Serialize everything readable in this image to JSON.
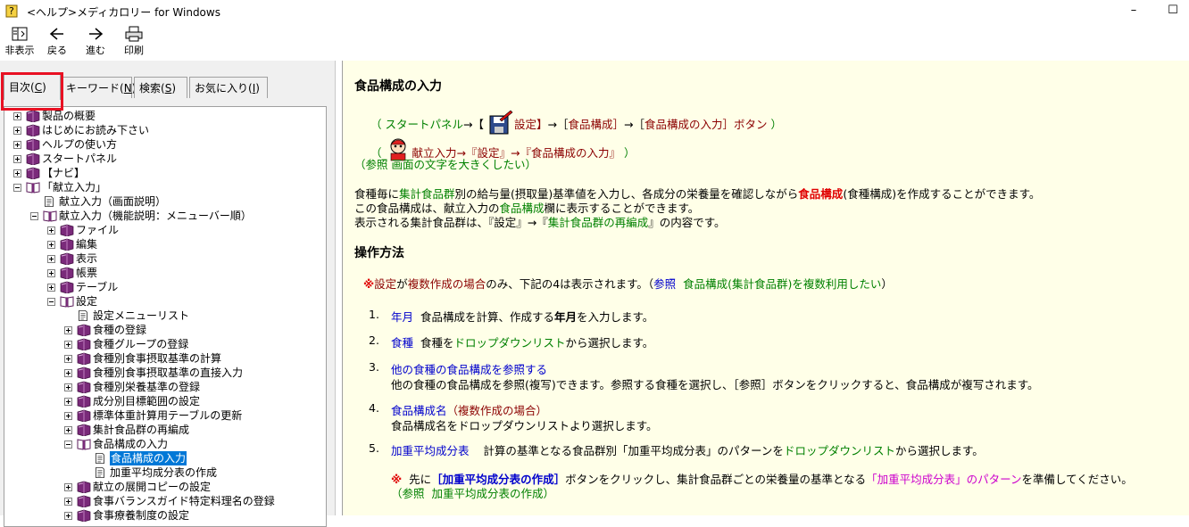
{
  "window": {
    "title": "<ヘルプ>メディカロリー for Windows",
    "minimize_glyph": "–",
    "maximize_glyph": "☐"
  },
  "toolbar": {
    "hide": "非表示",
    "back": "戻る",
    "forward": "進む",
    "print": "印刷"
  },
  "tabs": {
    "contents": "目次(C)",
    "contents_pre": "目次(",
    "contents_key": "C",
    "keyword_pre": "キーワード(",
    "keyword_key": "N",
    "search_pre": "検索(",
    "search_key": "S",
    "fav_pre": "お気に入り(",
    "fav_key": "I",
    "close": ")"
  },
  "tree": [
    {
      "label": "製品の概要",
      "level": 0,
      "type": "book",
      "exp": "plus"
    },
    {
      "label": "はじめにお読み下さい",
      "level": 0,
      "type": "book",
      "exp": "plus"
    },
    {
      "label": "ヘルプの使い方",
      "level": 0,
      "type": "book",
      "exp": "plus"
    },
    {
      "label": "スタートパネル",
      "level": 0,
      "type": "book",
      "exp": "plus"
    },
    {
      "label": "【ナビ】",
      "level": 0,
      "type": "book",
      "exp": "plus"
    },
    {
      "label": "「献立入力」",
      "level": 0,
      "type": "open",
      "exp": "minus"
    },
    {
      "label": "献立入力（画面説明）",
      "level": 1,
      "type": "page",
      "exp": ""
    },
    {
      "label": "献立入力（機能説明：メニューバー順）",
      "level": 1,
      "type": "open",
      "exp": "minus"
    },
    {
      "label": "ファイル",
      "level": 2,
      "type": "book",
      "exp": "plus"
    },
    {
      "label": "編集",
      "level": 2,
      "type": "book",
      "exp": "plus"
    },
    {
      "label": "表示",
      "level": 2,
      "type": "book",
      "exp": "plus"
    },
    {
      "label": "帳票",
      "level": 2,
      "type": "book",
      "exp": "plus"
    },
    {
      "label": "テーブル",
      "level": 2,
      "type": "book",
      "exp": "plus"
    },
    {
      "label": "設定",
      "level": 2,
      "type": "open",
      "exp": "minus"
    },
    {
      "label": "設定メニューリスト",
      "level": 3,
      "type": "page",
      "exp": ""
    },
    {
      "label": "食種の登録",
      "level": 3,
      "type": "book",
      "exp": "plus"
    },
    {
      "label": "食種グループの登録",
      "level": 3,
      "type": "book",
      "exp": "plus"
    },
    {
      "label": "食種別食事摂取基準の計算",
      "level": 3,
      "type": "book",
      "exp": "plus"
    },
    {
      "label": "食種別食事摂取基準の直接入力",
      "level": 3,
      "type": "book",
      "exp": "plus"
    },
    {
      "label": "食種別栄養基準の登録",
      "level": 3,
      "type": "book",
      "exp": "plus"
    },
    {
      "label": "成分別目標範囲の設定",
      "level": 3,
      "type": "book",
      "exp": "plus"
    },
    {
      "label": "標準体重計算用テーブルの更新",
      "level": 3,
      "type": "book",
      "exp": "plus"
    },
    {
      "label": "集計食品群の再編成",
      "level": 3,
      "type": "book",
      "exp": "plus"
    },
    {
      "label": "食品構成の入力",
      "level": 3,
      "type": "open",
      "exp": "minus"
    },
    {
      "label": "食品構成の入力",
      "level": 4,
      "type": "page",
      "exp": "",
      "selected": true
    },
    {
      "label": "加重平均成分表の作成",
      "level": 4,
      "type": "page",
      "exp": ""
    },
    {
      "label": "献立の展開コピーの設定",
      "level": 3,
      "type": "book",
      "exp": "plus"
    },
    {
      "label": "食事バランスガイド特定料理名の登録",
      "level": 3,
      "type": "book",
      "exp": "plus"
    },
    {
      "label": "食事療養制度の設定",
      "level": 3,
      "type": "book",
      "exp": "plus"
    }
  ],
  "content": {
    "title": "食品構成の入力",
    "nav1": {
      "open": "（",
      "start": "スタートパネル",
      "arrow_bracket": "→【",
      "settings_btn": "設定】",
      "arrow2": "→［",
      "food_comp": "食品構成］",
      "arrow3": "→［",
      "input_btn": "食品構成の入力］ボタン",
      "close": "）"
    },
    "nav2": {
      "open": "（",
      "path": "献立入力→『設定』→『食品構成の入力』",
      "close": "）"
    },
    "ref1": {
      "open": "（参照",
      "link": "画面の文字を大きくしたい",
      "close": "）"
    },
    "desc": {
      "l1a": "食種毎に",
      "l1b": "集計食品群",
      "l1c": "別の給与量(摂取量)基準値を入力し、各成分の栄養量を確認しながら",
      "l1d": "食品構成",
      "l1e": "(食種構成)を作成することができます。",
      "l2a": "この食品構成は、献立入力の",
      "l2b": "食品構成",
      "l2c": "欄に表示することができます。",
      "l3a": "表示される集計食品群は、『設定』→『",
      "l3b": "集計食品群の再編成",
      "l3c": "』の内容です。"
    },
    "op_title": "操作方法",
    "note": {
      "mark": "※",
      "a": "設定",
      "b": "が",
      "c": "複数作成の場合",
      "d": "のみ、下記の4は表示されます。（",
      "e": "参照",
      "f": "食品構成(集計食品群)を複数利用したい",
      "g": "）"
    },
    "items": {
      "n1": "1.",
      "i1a": "年月",
      "i1b": "食品構成を計算、作成する",
      "i1c": "年月",
      "i1d": "を入力します。",
      "n2": "2.",
      "i2a": "食種",
      "i2b": "食種を",
      "i2c": "ドロップダウンリスト",
      "i2d": "から選択します。",
      "n3": "3.",
      "i3a": "他の食種の食品構成を参照する",
      "i3b": "他の食種の食品構成を参照(複写)できます。参照する食種を選択し、［参照］ボタンをクリックすると、食品構成が複写されます。",
      "n4": "4.",
      "i4a": "食品構成名",
      "i4b": "（複数作成の場合）",
      "i4c": "食品構成名をドロップダウンリストより選択します。",
      "n5": "5.",
      "i5a": "加重平均成分表",
      "i5b": "計算の基準となる食品群別「加重平均成分表」のパターンを",
      "i5c": "ドロップダウンリスト",
      "i5d": "から選択します。",
      "n5mark": "※",
      "n5a": "先に",
      "n5b": "［加重平均成分表の作成］",
      "n5c": "ボタンをクリックし、集計食品群ごとの栄養量の基準となる",
      "n5d": "「加重平均成分表」のパターン",
      "n5e": "を準備してください。",
      "n5ref_open": "（参照",
      "n5ref": "加重平均成分表の作成",
      "n5ref_close": "）"
    }
  },
  "colors": {
    "content_bg": "#ffffe8",
    "link_green": "#008000",
    "link_blue": "#0000cc",
    "accent_red": "#e00000",
    "selection": "#0078d7",
    "highlight_box": "#e81123"
  }
}
